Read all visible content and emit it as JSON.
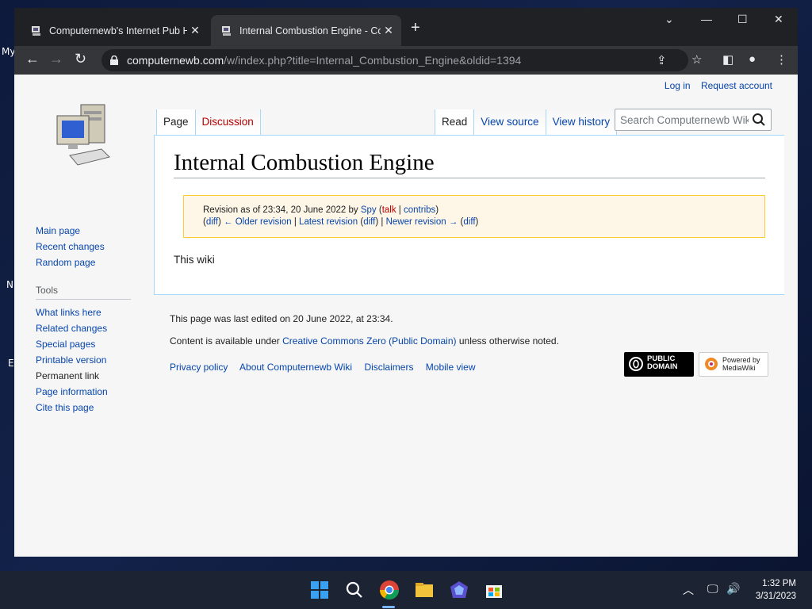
{
  "browser": {
    "tabs": [
      {
        "title": "Computernewb's Internet Pub Hub",
        "active": false
      },
      {
        "title": "Internal Combustion Engine - Computernewb Wiki",
        "active": true
      }
    ],
    "url_host": "computernewb.com",
    "url_path": "/w/index.php?title=Internal_Combustion_Engine&oldid=1394"
  },
  "wiki": {
    "personal_links": [
      "Log in",
      "Request account"
    ],
    "sidebar_nav": [
      "Main page",
      "Recent changes",
      "Random page"
    ],
    "tools_heading": "Tools",
    "tools": [
      "What links here",
      "Related changes",
      "Special pages",
      "Printable version",
      "Permanent link",
      "Page information",
      "Cite this page"
    ],
    "tabs_left": [
      "Page",
      "Discussion"
    ],
    "tabs_right": [
      "Read",
      "View source",
      "View history"
    ],
    "search_placeholder": "Search Computernewb Wiki",
    "title": "Internal Combustion Engine",
    "revision": {
      "prefix": "Revision as of 23:34, 20 June 2022 by",
      "user": "Spy",
      "talk": "talk",
      "contribs": "contribs",
      "diff": "diff",
      "older": "← Older revision",
      "latest": "Latest revision",
      "newer": "Newer revision →"
    },
    "body": "This wiki",
    "footer": {
      "last_edited": "This page was last edited on 20 June 2022, at 23:34.",
      "license_prefix": "Content is available under",
      "license_link": "Creative Commons Zero (Public Domain)",
      "license_suffix": "unless otherwise noted.",
      "links": [
        "Privacy policy",
        "About Computernewb Wiki",
        "Disclaimers",
        "Mobile view"
      ],
      "badge_pd": "PUBLIC DOMAIN",
      "badge_mw": "Powered by MediaWiki"
    }
  },
  "desktop": {
    "frag_top": "My",
    "frag_mid": "N",
    "frag_low": "E"
  },
  "taskbar": {
    "time": "1:32 PM",
    "date": "3/31/2023"
  }
}
